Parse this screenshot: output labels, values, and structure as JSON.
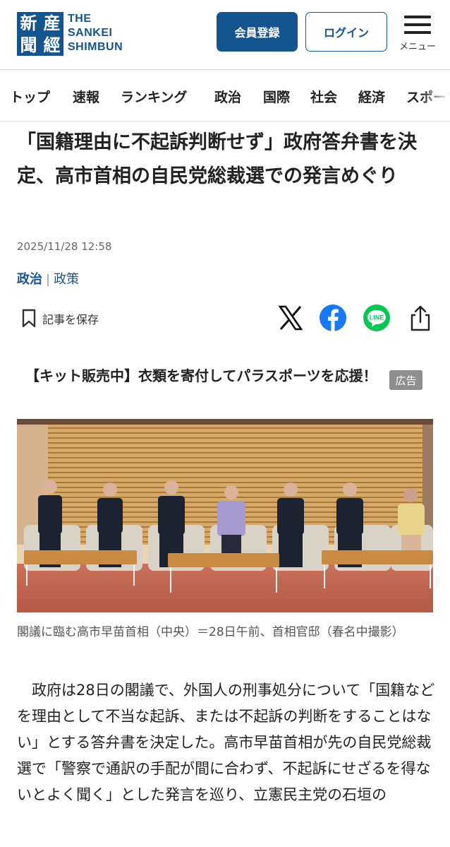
{
  "header": {
    "logo_kanji": [
      "産",
      "新",
      "經",
      "聞"
    ],
    "logo_lines": [
      "THE",
      "SANKEI",
      "SHIMBUN"
    ],
    "register_label": "会員登録",
    "login_label": "ログイン",
    "menu_label": "メニュー"
  },
  "nav": {
    "items": [
      "トップ",
      "速報",
      "ランキング",
      "政治",
      "国際",
      "社会",
      "経済",
      "スポーツ"
    ]
  },
  "article": {
    "title": "「国籍理由に不起訴判断せず」政府答弁書を決定、高市首相の自民党総裁選での発言めぐり",
    "date": "2025/11/28 12:58",
    "category_main": "政治",
    "category_separator": "|",
    "category_sub": "政策",
    "save_label": "記事を保存",
    "share_icons": [
      "x-icon",
      "facebook-icon",
      "line-icon",
      "share-icon"
    ],
    "line_badge": "LINE",
    "photo_caption": "閣議に臨む高市早苗首相（中央）＝28日午前、首相官邸（春名中撮影）",
    "body": "　政府は28日の閣議で、外国人の刑事処分について「国籍などを理由として不当な起訴、または不起訴の判断をすることはない」とする答弁書を決定した。高市早苗首相が先の自民党総裁選で「警察で通訳の手配が間に合わず、不起訴にせざるを得ないとよく聞く」とした発言を巡り、立憲民主党の石垣の"
  },
  "ad": {
    "text": "【キット販売中】衣類を寄付してパラスポーツを応援！",
    "badge": "広告"
  },
  "colors": {
    "brand": "#14558f",
    "facebook": "#1877f2",
    "line": "#06c755"
  }
}
